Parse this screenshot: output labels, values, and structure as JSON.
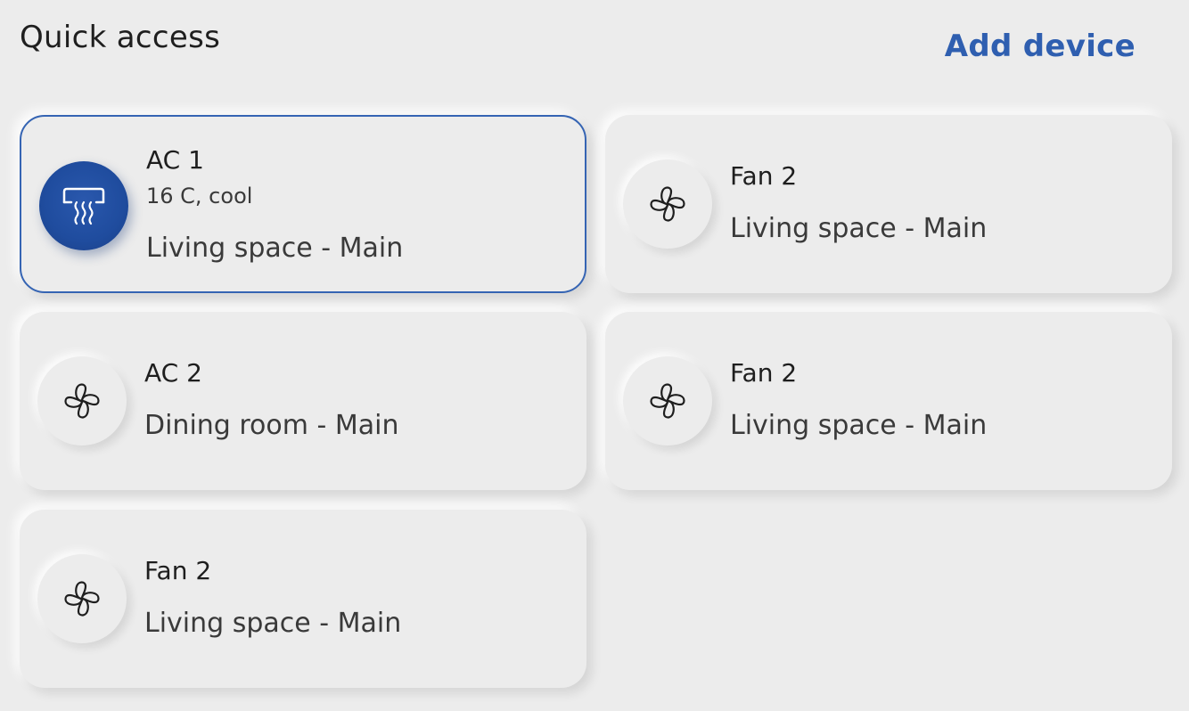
{
  "header": {
    "title": "Quick access",
    "add_device_label": "Add device"
  },
  "colors": {
    "accent": "#2f5fb0",
    "active_icon_bg": "#1f4c9e",
    "background": "#ececec"
  },
  "devices": [
    {
      "name": "AC 1",
      "status": "16 C, cool",
      "location": "Living space - Main",
      "icon": "air-conditioner-icon",
      "selected": true
    },
    {
      "name": "Fan 2",
      "location": "Living space - Main",
      "icon": "fan-icon",
      "selected": false
    },
    {
      "name": "AC 2",
      "location": "Dining room - Main",
      "icon": "fan-icon",
      "selected": false
    },
    {
      "name": "Fan 2",
      "location": "Living space - Main",
      "icon": "fan-icon",
      "selected": false
    },
    {
      "name": "Fan 2",
      "location": "Living space - Main",
      "icon": "fan-icon",
      "selected": false
    }
  ]
}
